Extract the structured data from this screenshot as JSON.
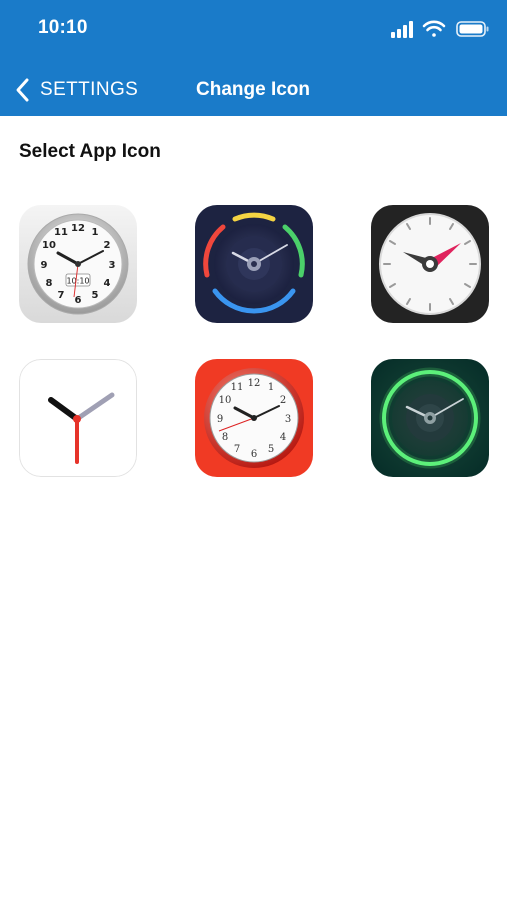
{
  "status_bar": {
    "time": "10:10",
    "icons": [
      "signal-bars-icon",
      "wifi-icon",
      "battery-icon"
    ]
  },
  "nav": {
    "back_label": "SETTINGS",
    "title": "Change Icon"
  },
  "section_title": "Select App Icon",
  "app_icons": [
    {
      "name": "classic-silver-clock",
      "date_label": "10:10",
      "numbers": [
        "12",
        "1",
        "2",
        "3",
        "4",
        "5",
        "6",
        "7",
        "8",
        "9",
        "10",
        "11"
      ]
    },
    {
      "name": "dark-multicolor-ring-clock"
    },
    {
      "name": "dark-minimal-white-clock"
    },
    {
      "name": "minimal-hands-clock"
    },
    {
      "name": "red-frame-clock",
      "numbers": [
        "12",
        "1",
        "2",
        "3",
        "4",
        "5",
        "6",
        "7",
        "8",
        "9",
        "10",
        "11"
      ]
    },
    {
      "name": "green-glow-clock"
    }
  ],
  "colors": {
    "header_bg": "#1a7bc9",
    "header_text": "#ffffff",
    "accent_red": "#e6332a",
    "accent_green": "#4cd964"
  }
}
